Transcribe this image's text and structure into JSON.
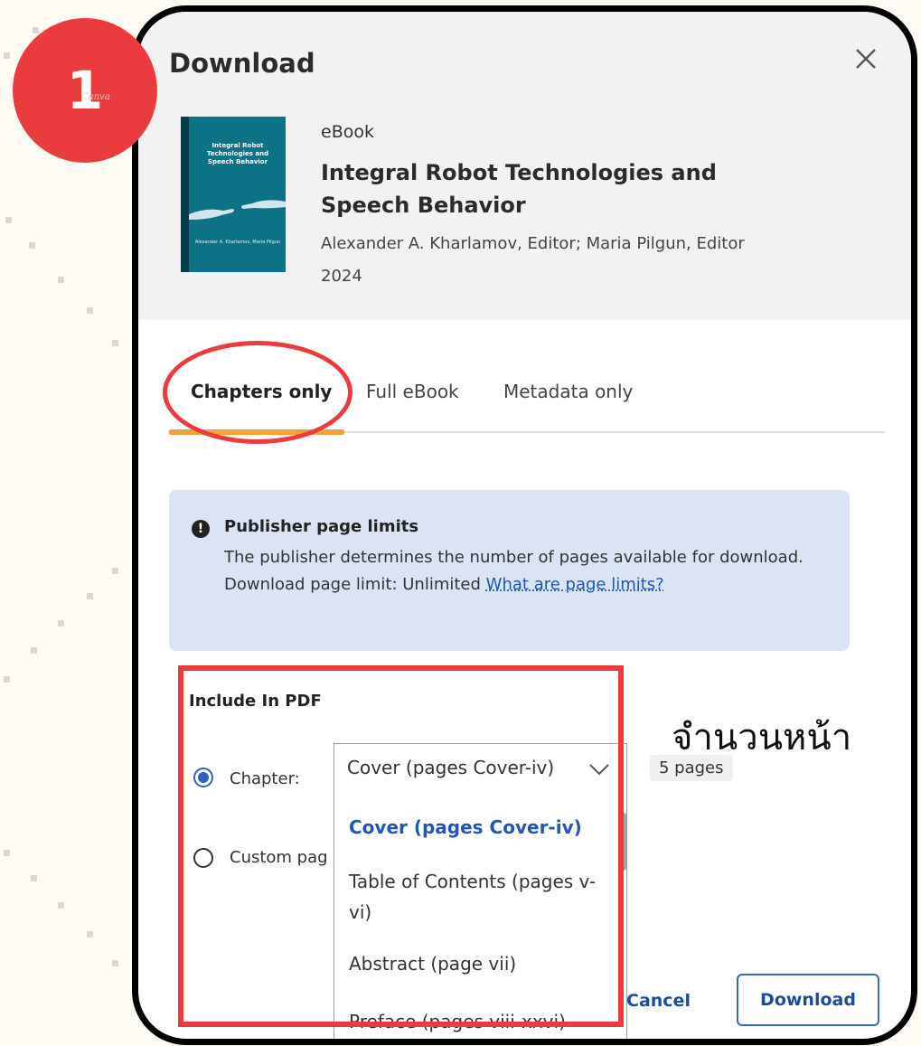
{
  "badge": {
    "number": "1",
    "watermark": "Canva"
  },
  "dialog": {
    "title": "Download",
    "close_icon": "close-icon"
  },
  "book": {
    "type": "eBook",
    "title": "Integral Robot Technologies and Speech Behavior",
    "authors": "Alexander A. Kharlamov, Editor; Maria Pilgun, Editor",
    "year": "2024",
    "cover": {
      "title": "Integral Robot Technologies and Speech Behavior",
      "editors": "Alexander A. Kharlamov, Maria Pilgun"
    }
  },
  "tabs": [
    {
      "label": "Chapters only",
      "active": true
    },
    {
      "label": "Full eBook",
      "active": false
    },
    {
      "label": "Metadata only",
      "active": false
    }
  ],
  "info": {
    "heading": "Publisher page limits",
    "text": "The publisher determines the number of pages available for download.",
    "limit_text": "Download page limit: Unlimited",
    "link": "What are page limits?"
  },
  "include": {
    "label": "Include In PDF",
    "chapter_label": "Chapter:",
    "custom_label": "Custom pag",
    "selected_value": "Cover (pages Cover-iv)",
    "options": [
      "Cover (pages Cover-iv)",
      "Table of Contents (pages v-vi)",
      "Abstract (page vii)",
      "Preface (pages viii-xxvi)"
    ],
    "page_count": "5 pages"
  },
  "annotation": {
    "thai_note": "จำนวนหน้า"
  },
  "footer": {
    "cancel": "Cancel",
    "download": "Download"
  },
  "colors": {
    "accent": "#f0a23a",
    "annotation_red": "#ea3b3e",
    "link_blue": "#1f56b6",
    "info_bg": "#dbe4f5",
    "header_bg": "#f2f2f2"
  }
}
